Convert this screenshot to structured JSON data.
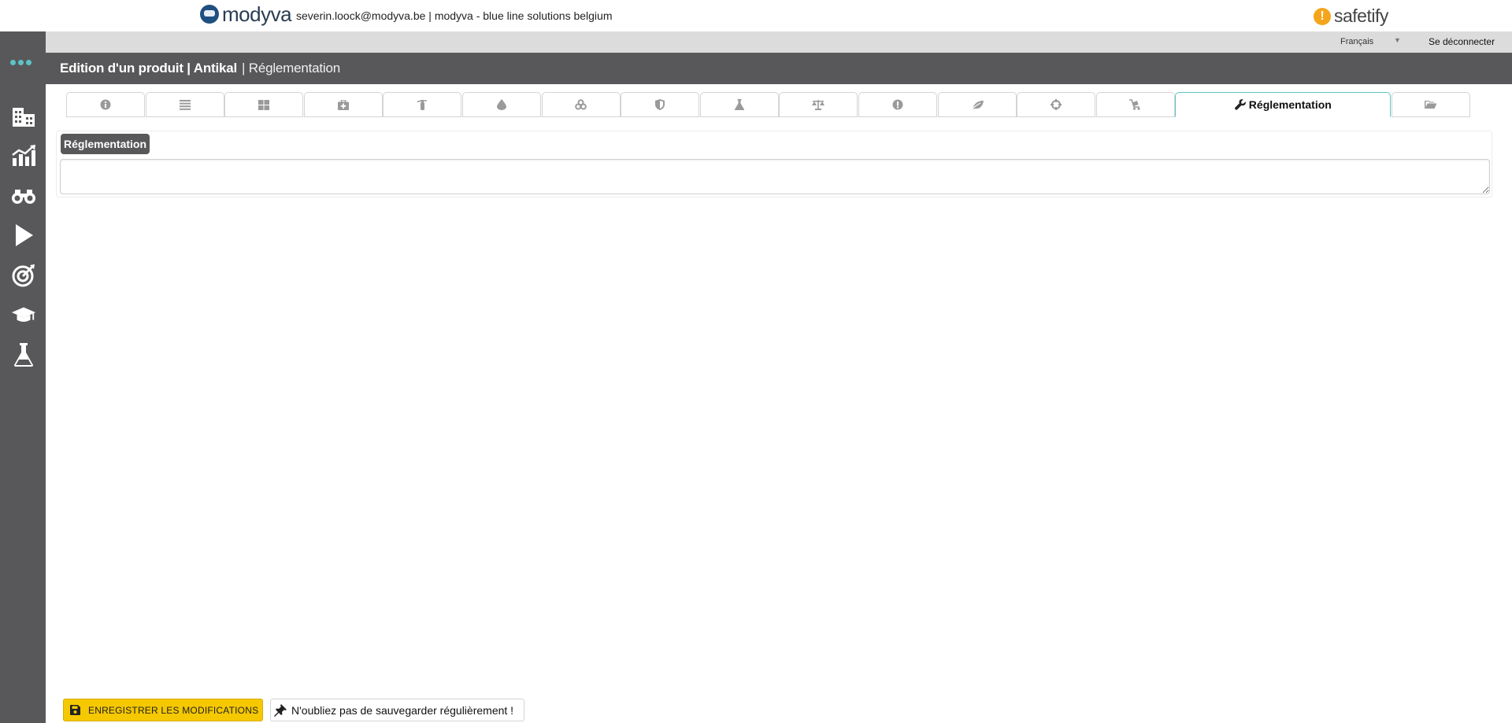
{
  "top": {
    "brand_name": "modyva",
    "user_info": "severin.loock@modyva.be | modyva - blue line solutions belgium",
    "safetify_name": "safetify",
    "safetify_mark": "!"
  },
  "subbar": {
    "language": "Français",
    "logout": "Se déconnecter"
  },
  "header": {
    "title": "Edition d'un produit | Antikal",
    "subtitle": "| Réglementation"
  },
  "sidebar": {
    "items": [
      "building-icon",
      "chart-icon",
      "binoculars-icon",
      "play-icon",
      "target-icon",
      "graduation-cap-icon",
      "flask-icon"
    ]
  },
  "tabs": {
    "active_label": "Réglementation",
    "icons": [
      "info-icon",
      "list-icon",
      "grid-icon",
      "first-aid-icon",
      "extinguisher-icon",
      "drop-icon",
      "biohazard-icon",
      "shield-icon",
      "flask-icon",
      "scale-icon",
      "warning-icon",
      "leaf-icon",
      "crosshair-icon",
      "cart-icon",
      "wrench-icon",
      "folder-icon"
    ]
  },
  "section": {
    "label": "Réglementation",
    "value": ""
  },
  "footer": {
    "save_label": "ENREGISTRER LES MODIFICATIONS",
    "reminder": "N'oubliez pas de sauvegarder régulièrement !"
  },
  "colors": {
    "sidebar": "#58585a",
    "accent": "#5ec3c4",
    "save_button": "#f5c800",
    "safetify": "#f4a51c"
  }
}
